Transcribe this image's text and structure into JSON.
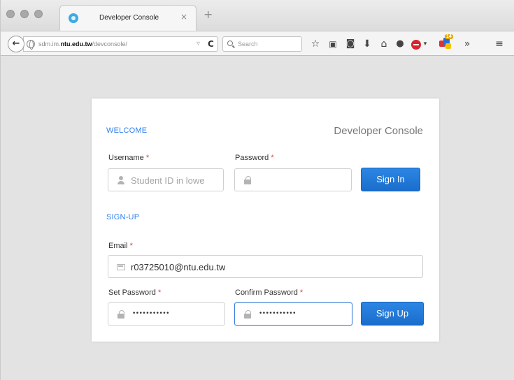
{
  "browser": {
    "tab": {
      "title": "Developer Console",
      "close_glyph": "×",
      "icon": "site-favicon"
    },
    "new_tab_glyph": "+",
    "url": {
      "prefix": "sdm.im.",
      "domain": "ntu.edu.tw",
      "path": "/devconsole/"
    },
    "search_placeholder": "Search",
    "extension_badge_count": "14",
    "toolbar_icons": [
      "bookmark-star-icon",
      "reading-list-icon",
      "pocket-icon",
      "downloads-icon",
      "home-icon",
      "chat-icon",
      "adblock-icon",
      "extension-icon",
      "overflow-icon",
      "menu-icon"
    ]
  },
  "card": {
    "welcome_label": "WELCOME",
    "title": "Developer Console",
    "signin": {
      "username_label": "Username",
      "username_placeholder": "Student ID in lowe",
      "password_label": "Password",
      "password_value": "",
      "button": "Sign In"
    },
    "signup_label": "SIGN-UP",
    "signup": {
      "email_label": "Email",
      "email_value": "r03725010@ntu.edu.tw",
      "set_password_label": "Set Password",
      "set_password_mask": "•••••••••••",
      "confirm_password_label": "Confirm Password",
      "confirm_password_mask": "•••••••••••",
      "button": "Sign Up"
    },
    "required_marker": "*"
  },
  "colors": {
    "accent": "#2f80ed",
    "button": "#1a6dcc",
    "required": "#d64545",
    "page_background": "#e3e3e3"
  }
}
